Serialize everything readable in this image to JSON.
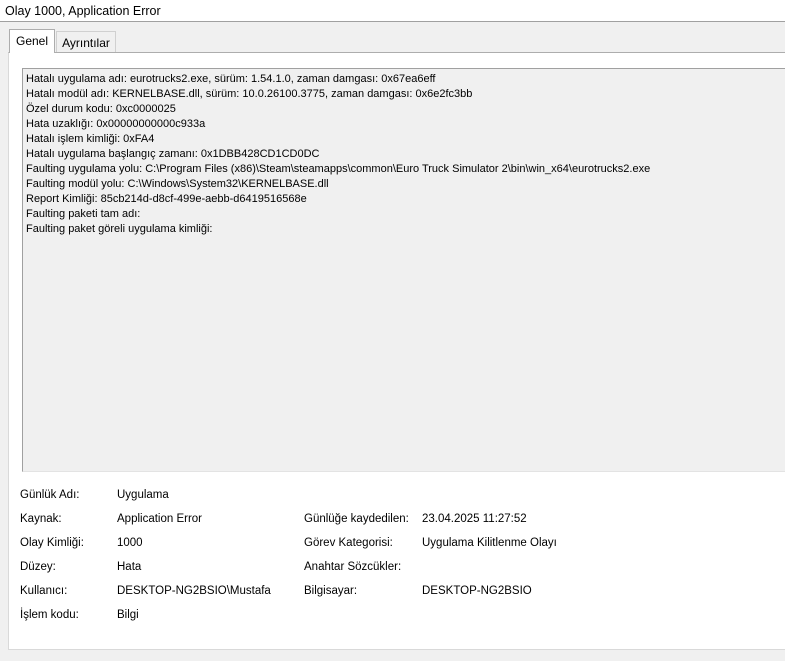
{
  "window": {
    "title": "Olay 1000, Application Error"
  },
  "tabs": [
    {
      "label": "Genel"
    },
    {
      "label": "Ayrıntılar"
    }
  ],
  "description": [
    "Hatalı uygulama adı: eurotrucks2.exe, sürüm: 1.54.1.0, zaman damgası: 0x67ea6eff",
    "Hatalı modül adı: KERNELBASE.dll, sürüm: 10.0.26100.3775, zaman damgası: 0x6e2fc3bb",
    "Özel durum kodu: 0xc0000025",
    "Hata uzaklığı: 0x00000000000c933a",
    "Hatalı işlem kimliği: 0xFA4",
    "Hatalı uygulama başlangıç zamanı: 0x1DBB428CD1CD0DC",
    "Faulting uygulama yolu: C:\\Program Files (x86)\\Steam\\steamapps\\common\\Euro Truck Simulator 2\\bin\\win_x64\\eurotrucks2.exe",
    "Faulting modül yolu: C:\\Windows\\System32\\KERNELBASE.dll",
    "Report Kimliği: 85cb214d-d8cf-499e-aebb-d6419516568e",
    "Faulting paketi tam adı:",
    "Faulting paket göreli uygulama kimliği:"
  ],
  "fields": {
    "log_name": {
      "label": "Günlük Adı:",
      "value": "Uygulama"
    },
    "source": {
      "label": "Kaynak:",
      "value": "Application Error"
    },
    "logged": {
      "label": "Günlüğe kaydedilen:",
      "value": "23.04.2025 11:27:52"
    },
    "event_id": {
      "label": "Olay Kimliği:",
      "value": "1000"
    },
    "task_category": {
      "label": "Görev Kategorisi:",
      "value": "Uygulama Kilitlenme Olayı"
    },
    "level": {
      "label": "Düzey:",
      "value": "Hata"
    },
    "keywords": {
      "label": "Anahtar Sözcükler:",
      "value": ""
    },
    "user": {
      "label": "Kullanıcı:",
      "value": "DESKTOP-NG2BSIO\\Mustafa"
    },
    "computer": {
      "label": "Bilgisayar:",
      "value": "DESKTOP-NG2BSIO"
    },
    "opcode": {
      "label": "İşlem kodu:",
      "value": "Bilgi"
    }
  }
}
